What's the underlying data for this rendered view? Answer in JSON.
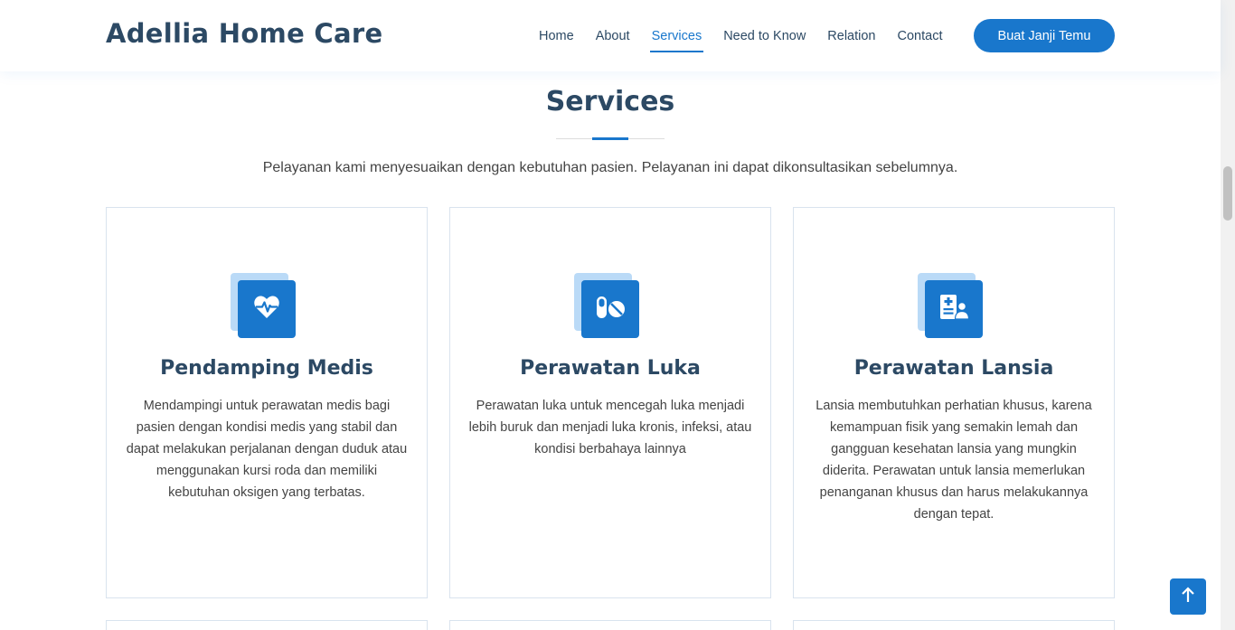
{
  "header": {
    "logo": "Adellia Home Care",
    "nav": [
      {
        "label": "Home",
        "active": false
      },
      {
        "label": "About",
        "active": false
      },
      {
        "label": "Services",
        "active": true
      },
      {
        "label": "Need to Know",
        "active": false
      },
      {
        "label": "Relation",
        "active": false
      },
      {
        "label": "Contact",
        "active": false
      }
    ],
    "cta_label": "Buat Janji Temu"
  },
  "services": {
    "title": "Services",
    "subtitle": "Pelayanan kami menyesuaikan dengan kebutuhan pasien. Pelayanan ini dapat dikonsultasikan sebelumnya.",
    "cards": [
      {
        "icon": "heart-pulse-icon",
        "title": "Pendamping Medis",
        "text": "Mendampingi untuk perawatan medis bagi pasien dengan kondisi medis yang stabil dan dapat melakukan perjalanan dengan duduk atau menggunakan kursi roda dan memiliki kebutuhan oksigen yang terbatas."
      },
      {
        "icon": "pills-icon",
        "title": "Perawatan Luka",
        "text": "Perawatan luka untuk mencegah luka menjadi lebih buruk dan menjadi luka kronis, infeksi, atau kondisi berbahaya lainnya"
      },
      {
        "icon": "medical-record-icon",
        "title": "Perawatan Lansia",
        "text": "Lansia membutuhkan perhatian khusus, karena kemampuan fisik yang semakin lemah dan gangguan kesehatan lansia yang mungkin diderita. Perawatan untuk lansia memerlukan penanganan khusus dan harus melakukannya dengan tepat."
      }
    ]
  },
  "colors": {
    "accent": "#1977cc",
    "heading": "#2c4964",
    "icon_back": "#badaf7"
  },
  "back_to_top_icon": "arrow-up-icon"
}
